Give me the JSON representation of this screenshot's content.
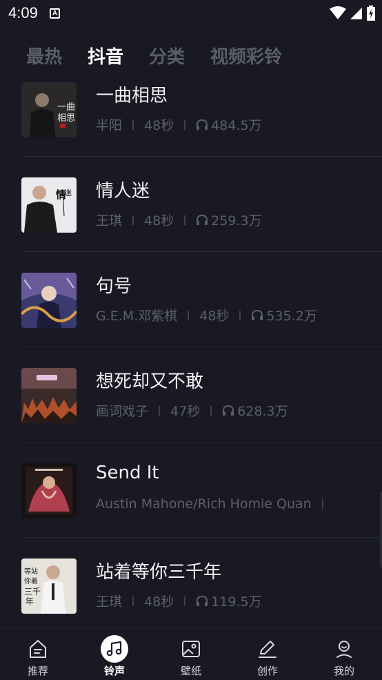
{
  "status_bar": {
    "time": "4:09",
    "notification_letter": "A"
  },
  "tabs": [
    {
      "label": "最热",
      "active": false
    },
    {
      "label": "抖音",
      "active": true
    },
    {
      "label": "分类",
      "active": false
    },
    {
      "label": "视频彩铃",
      "active": false
    }
  ],
  "songs": [
    {
      "title": "一曲相思",
      "artist": "半阳",
      "duration": "48秒",
      "plays": "484.5万",
      "cover_icon": "album-cover-yiqu-xiangsi"
    },
    {
      "title": "情人迷",
      "artist": "王琪",
      "duration": "48秒",
      "plays": "259.3万",
      "cover_icon": "album-cover-qingren-mi"
    },
    {
      "title": "句号",
      "artist": "G.E.M.邓紫棋",
      "duration": "48秒",
      "plays": "535.2万",
      "cover_icon": "album-cover-juhao"
    },
    {
      "title": "想死却又不敢",
      "artist": "画词戏子",
      "duration": "47秒",
      "plays": "628.3万",
      "cover_icon": "album-cover-xiangsi-queyou-bugan"
    },
    {
      "title": "Send It",
      "artist": "Austin Mahone/Rich Homie Quan",
      "duration": "",
      "plays": "",
      "cover_icon": "album-cover-send-it"
    },
    {
      "title": "站着等你三千年",
      "artist": "王琪",
      "duration": "48秒",
      "plays": "119.5万",
      "cover_icon": "album-cover-zhanzhe-dengni"
    }
  ],
  "bottom_nav": [
    {
      "label": "推荐",
      "icon": "recommend-icon",
      "active": false
    },
    {
      "label": "铃声",
      "icon": "music-note-icon",
      "active": true
    },
    {
      "label": "壁纸",
      "icon": "wallpaper-icon",
      "active": false
    },
    {
      "label": "创作",
      "icon": "pencil-icon",
      "active": false
    },
    {
      "label": "我的",
      "icon": "profile-icon",
      "active": false
    }
  ],
  "colors": {
    "background": "#181923",
    "tab_inactive": "#5b5d6b",
    "meta_text": "#5d5f6d",
    "title_text": "#f2f2f5"
  }
}
